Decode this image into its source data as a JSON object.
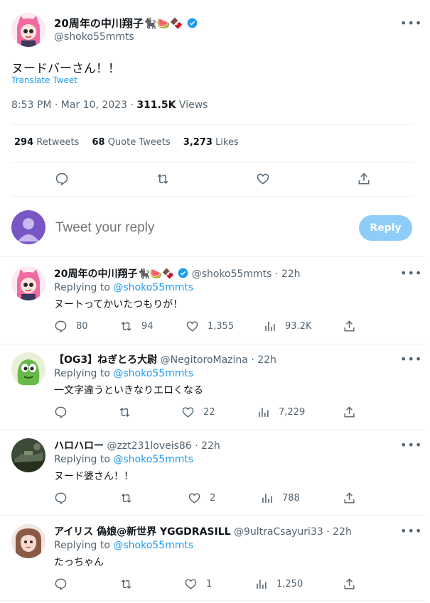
{
  "main_tweet": {
    "display_name": "20周年の中川翔子🐈‍⬛🍉🍫",
    "handle": "@shoko55mmts",
    "text": "ヌードバーさん！！",
    "translate_label": "Translate Tweet",
    "time": "8:53 PM · Mar 10, 2023 · ",
    "views_count": "311.5K",
    "views_label": "Views",
    "retweets_count": "294",
    "retweets_label": "Retweets",
    "quotes_count": "68",
    "quotes_label": "Quote Tweets",
    "likes_count": "3,273",
    "likes_label": "Likes"
  },
  "composer": {
    "placeholder": "Tweet your reply",
    "reply_button": "Reply"
  },
  "replies": [
    {
      "display_name": "20周年の中川翔子🐈‍⬛🍉🍫",
      "handle": "@shoko55mmts",
      "time": "22h",
      "replying_prefix": "Replying to",
      "replying_handle": "@shoko55mmts",
      "text": "ヌートってかいたつもりが！",
      "replies": "80",
      "retweets": "94",
      "likes": "1,355",
      "views": "93.2K",
      "verified": true
    },
    {
      "display_name": "【OG3】ねぎとろ大尉",
      "handle": "@NegitoroMazina",
      "time": "22h",
      "replying_prefix": "Replying to",
      "replying_handle": "@shoko55mmts",
      "text": "一文字違うといきなりエロくなる",
      "replies": "",
      "retweets": "",
      "likes": "22",
      "views": "7,229",
      "verified": false
    },
    {
      "display_name": "ハロハロー",
      "handle": "@zzt231loveis86",
      "time": "22h",
      "replying_prefix": "Replying to",
      "replying_handle": "@shoko55mmts",
      "text": "ヌード婆さん！！",
      "replies": "",
      "retweets": "",
      "likes": "2",
      "views": "788",
      "verified": false
    },
    {
      "display_name": "アイリス 偽娘@新世界 YGGDRASILL",
      "handle": "@9ultraCsayuri33",
      "time": "22h",
      "replying_prefix": "Replying to",
      "replying_handle": "@shoko55mmts",
      "text": "たっちゃん",
      "replies": "",
      "retweets": "",
      "likes": "1",
      "views": "1,250",
      "verified": false
    }
  ],
  "colors": {
    "accent": "#1d9bf0",
    "reply_button_disabled": "#8ecdf8",
    "secondary_text": "#536471"
  }
}
